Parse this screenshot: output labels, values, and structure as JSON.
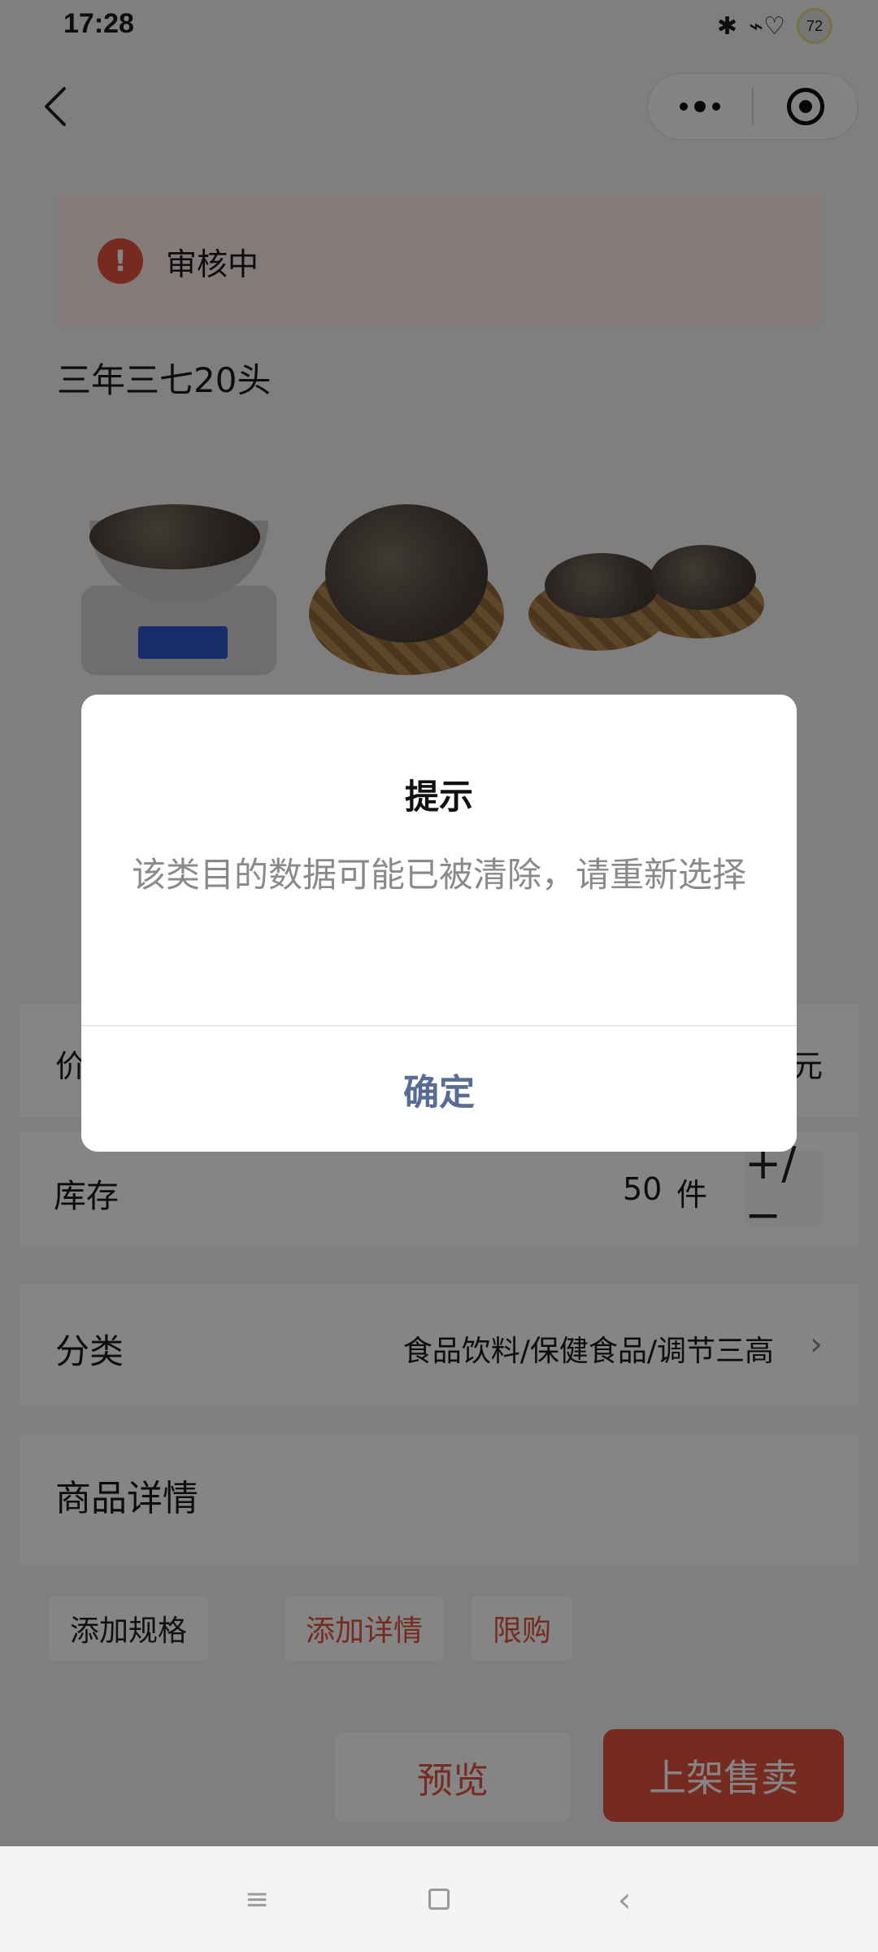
{
  "status_bar": {
    "time": "17:28",
    "battery": "72"
  },
  "review": {
    "text": "审核中"
  },
  "product": {
    "title": "三年三七20头"
  },
  "form": {
    "price_label": "价",
    "price_unit": "元",
    "stock_label": "库存",
    "stock_value": "50",
    "stock_unit": "件",
    "stock_toggle": "+/−",
    "category_label": "分类",
    "category_value": "食品饮料/保健食品/调节三高",
    "detail_label": "商品详情"
  },
  "actions": {
    "add_spec": "添加规格",
    "add_detail": "添加详情",
    "limit": "限购"
  },
  "bottom": {
    "preview": "预览",
    "publish": "上架售卖"
  },
  "dialog": {
    "title": "提示",
    "message": "该类目的数据可能已被清除，请重新选择",
    "confirm": "确定"
  },
  "colors": {
    "accent": "#e5533e",
    "dialog_link": "#576b95"
  },
  "icons": [
    "back-arrow-icon",
    "more-icon",
    "close-target-icon",
    "alert-icon",
    "chevron-right-icon",
    "menu-icon",
    "home-icon",
    "back-icon"
  ]
}
